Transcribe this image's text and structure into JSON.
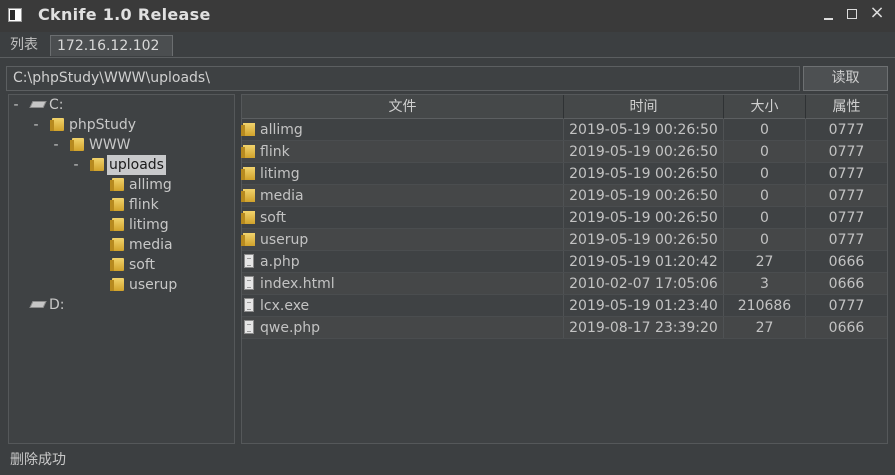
{
  "window": {
    "title": "Cknife 1.0 Release",
    "close_glyph": "×"
  },
  "tabs": [
    {
      "label": "列表"
    },
    {
      "label": "172.16.12.102"
    }
  ],
  "pathbar": {
    "path": "C:\\phpStudy\\WWW\\uploads\\",
    "read_button": "读取"
  },
  "tree": {
    "toggle_glyph": "-",
    "drive_c": "C:",
    "phpstudy": "phpStudy",
    "www": "WWW",
    "uploads": "uploads",
    "children": [
      "allimg",
      "flink",
      "litimg",
      "media",
      "soft",
      "userup"
    ],
    "drive_d": "D:"
  },
  "files": {
    "headers": {
      "name": "文件",
      "time": "时间",
      "size": "大小",
      "attr": "属性"
    },
    "rows": [
      {
        "name": "allimg",
        "time": "2019-05-19 00:26:50",
        "size": "0",
        "attr": "0777",
        "type": "folder"
      },
      {
        "name": "flink",
        "time": "2019-05-19 00:26:50",
        "size": "0",
        "attr": "0777",
        "type": "folder"
      },
      {
        "name": "litimg",
        "time": "2019-05-19 00:26:50",
        "size": "0",
        "attr": "0777",
        "type": "folder"
      },
      {
        "name": "media",
        "time": "2019-05-19 00:26:50",
        "size": "0",
        "attr": "0777",
        "type": "folder"
      },
      {
        "name": "soft",
        "time": "2019-05-19 00:26:50",
        "size": "0",
        "attr": "0777",
        "type": "folder"
      },
      {
        "name": "userup",
        "time": "2019-05-19 00:26:50",
        "size": "0",
        "attr": "0777",
        "type": "folder"
      },
      {
        "name": "a.php",
        "time": "2019-05-19 01:20:42",
        "size": "27",
        "attr": "0666",
        "type": "file"
      },
      {
        "name": "index.html",
        "time": "2010-02-07 17:05:06",
        "size": "3",
        "attr": "0666",
        "type": "file"
      },
      {
        "name": "lcx.exe",
        "time": "2019-05-19 01:23:40",
        "size": "210686",
        "attr": "0777",
        "type": "file"
      },
      {
        "name": "qwe.php",
        "time": "2019-08-17 23:39:20",
        "size": "27",
        "attr": "0666",
        "type": "file"
      }
    ]
  },
  "status": "删除成功"
}
